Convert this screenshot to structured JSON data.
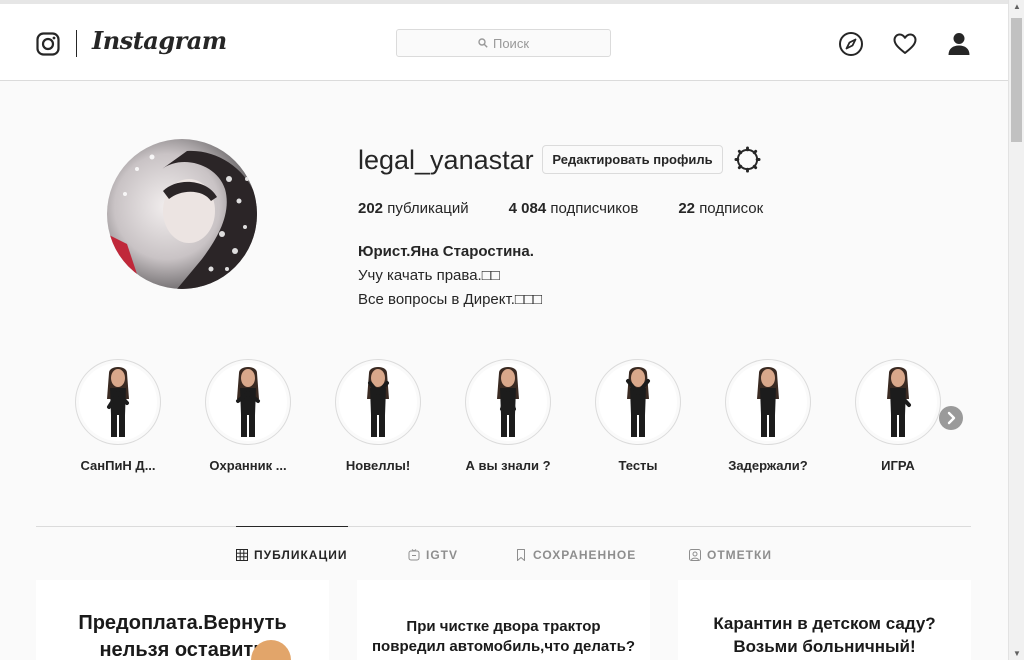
{
  "header": {
    "brand": "Instagram",
    "search_placeholder": "Поиск",
    "icons": [
      "instagram-glyph-icon",
      "compass-icon",
      "heart-icon",
      "profile-icon"
    ]
  },
  "profile": {
    "username": "legal_yanastar",
    "edit_button": "Редактировать профиль",
    "stats": {
      "posts_count": "202",
      "posts_label": "публикаций",
      "followers_count": "4 084",
      "followers_label": "подписчиков",
      "following_count": "22",
      "following_label": "подписок"
    },
    "bio": {
      "name": "Юрист.Яна Старостина.",
      "line1": "Учу качать права.□□",
      "line2": "Все вопросы в Директ.□□□"
    }
  },
  "highlights": [
    {
      "label": "СанПиН Д..."
    },
    {
      "label": "Охранник ..."
    },
    {
      "label": "Новеллы!"
    },
    {
      "label": "А вы знали ?"
    },
    {
      "label": "Тесты"
    },
    {
      "label": "Задержали?"
    },
    {
      "label": "ИГРА"
    }
  ],
  "tabs": {
    "posts": "ПУБЛИКАЦИИ",
    "igtv": "IGTV",
    "saved": "СОХРАНЕННОЕ",
    "tagged": "ОТМЕТКИ"
  },
  "posts": [
    {
      "line1": "Предоплата.Вернуть",
      "line2": "нельзя оставить"
    },
    {
      "line1": "При чистке двора трактор",
      "line2": "повредил автомобиль,что делать?"
    },
    {
      "line1": "Карантин в детском саду?",
      "line2": "Возьми больничный!"
    }
  ],
  "colors": {
    "background": "#fafafa",
    "text": "#262626",
    "border": "#dbdbdb",
    "muted": "#8e8e8e"
  }
}
